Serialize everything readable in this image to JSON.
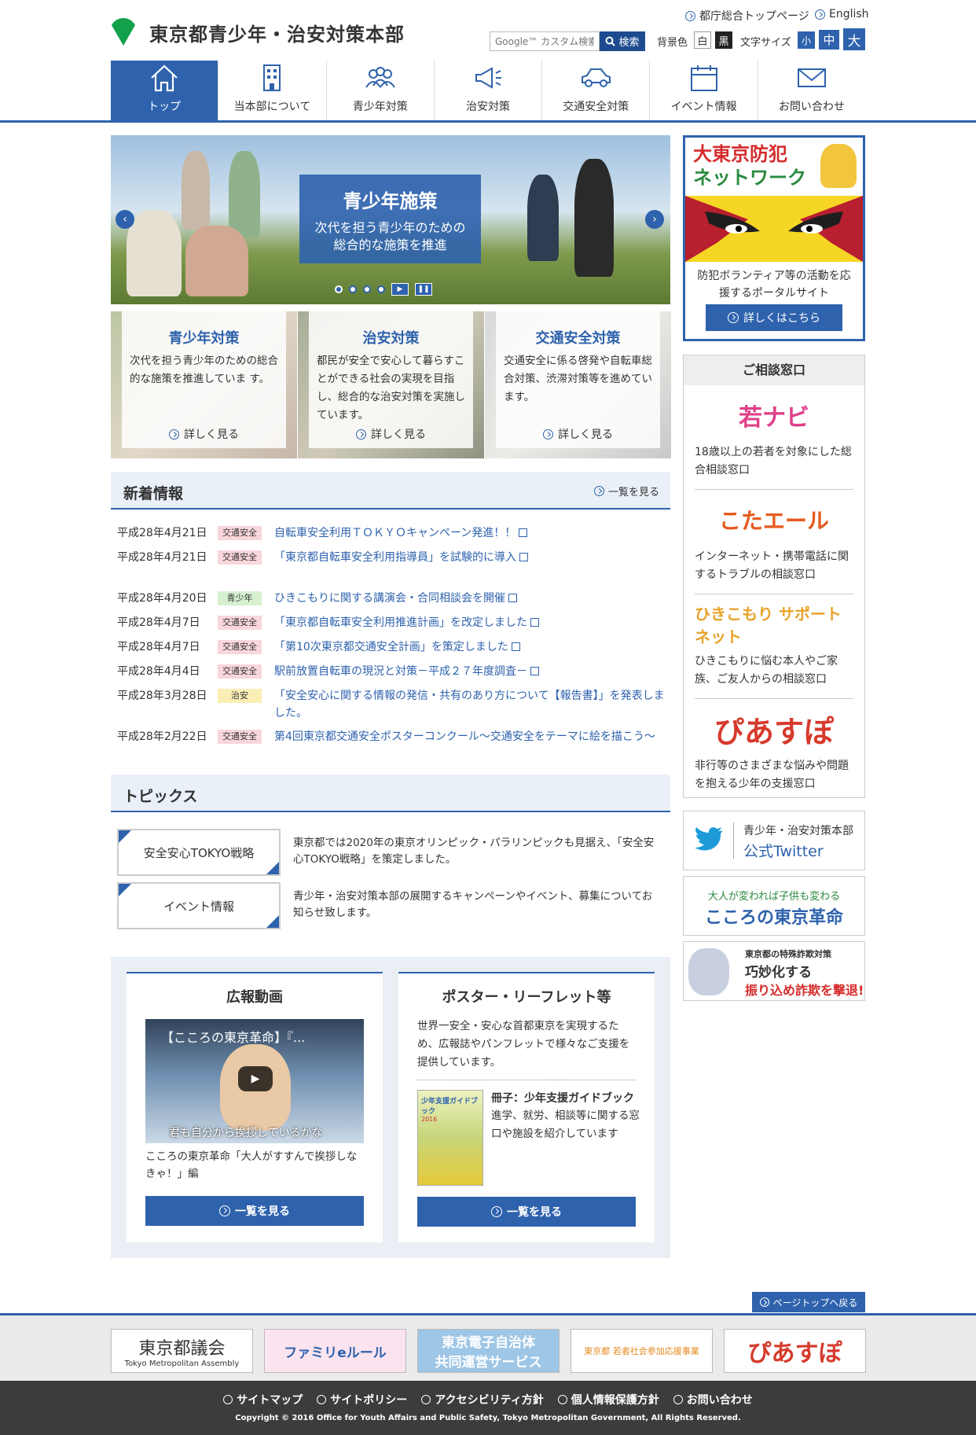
{
  "header": {
    "site_title": "東京都青少年・治安対策本部",
    "link_metro_top": "都庁総合トップページ",
    "link_english": "English",
    "search_placeholder": "Google™ カスタム検索",
    "search_button": "検索",
    "bg_color_label": "背景色",
    "bg_white": "白",
    "bg_black": "黒",
    "font_size_label": "文字サイズ",
    "font_small": "小",
    "font_medium": "中",
    "font_large": "大",
    "brand_color": "#2e62ad"
  },
  "nav": {
    "items": [
      {
        "label": "トップ",
        "icon": "home-icon"
      },
      {
        "label": "当本部について",
        "icon": "building-icon"
      },
      {
        "label": "青少年対策",
        "icon": "people-icon"
      },
      {
        "label": "治安対策",
        "icon": "megaphone-icon"
      },
      {
        "label": "交通安全対策",
        "icon": "car-icon"
      },
      {
        "label": "イベント情報",
        "icon": "calendar-icon"
      },
      {
        "label": "お問い合わせ",
        "icon": "mail-icon"
      }
    ]
  },
  "hero": {
    "title": "青少年施策",
    "subtitle_line1": "次代を担う青少年のための",
    "subtitle_line2": "総合的な施策を推進"
  },
  "features": [
    {
      "title": "青少年対策",
      "text": "次代を担う青少年のための総合的な施策を推進していま す。",
      "more": "詳しく見る"
    },
    {
      "title": "治安対策",
      "text": "都民が安全で安心して暮らすことができる社会の実現を目指し、総合的な治安対策を実施しています。",
      "more": "詳しく見る"
    },
    {
      "title": "交通安全対策",
      "text": "交通安全に係る啓発や自転車総合対策、渋滞対策等を進めています。",
      "more": "詳しく見る"
    }
  ],
  "news": {
    "heading": "新着情報",
    "more": "一覧を見る",
    "items": [
      {
        "date": "平成28年4月21日",
        "cat": "交通安全",
        "title": "自転車安全利用ＴＯＫＹＯキャンペーン発進！！"
      },
      {
        "date": "平成28年4月21日",
        "cat": "交通安全",
        "title": "「東京都自転車安全利用指導員」を試験的に導入"
      },
      {
        "date": "平成28年4月20日",
        "cat": "青少年",
        "title": "ひきこもりに関する講演会・合同相談会を開催"
      },
      {
        "date": "平成28年4月7日",
        "cat": "交通安全",
        "title": "「東京都自転車安全利用推進計画」を改定しました"
      },
      {
        "date": "平成28年4月7日",
        "cat": "交通安全",
        "title": "「第10次東京都交通安全計画」を策定しました"
      },
      {
        "date": "平成28年4月4日",
        "cat": "交通安全",
        "title": "駅前放置自転車の現況と対策－平成２７年度調査－"
      },
      {
        "date": "平成28年3月28日",
        "cat": "治安",
        "title": "「安全安心に関する情報の発信・共有のあり方について【報告書】」を発表しました。"
      },
      {
        "date": "平成28年2月22日",
        "cat": "交通安全",
        "title": "第4回東京都交通安全ポスターコンクール～交通安全をテーマに絵を描こう～"
      }
    ]
  },
  "topics": {
    "heading": "トピックス",
    "items": [
      {
        "button": "安全安心TOKYO戦略",
        "desc": "東京都では2020年の東京オリンピック・パラリンピックも見据え、「安全安心TOKYO戦略」を策定しました。"
      },
      {
        "button": "イベント情報",
        "desc": "青少年・治安対策本部の展開するキャンペーンやイベント、募集についてお知らせ致します。"
      }
    ]
  },
  "video_card": {
    "title": "広報動画",
    "video_title": "【こころの東京革命】『...",
    "video_subtitle": "君も自分から挨拶しているかな",
    "caption": "こころの東京革命「大人がすすんで挨拶しなきゃ！」編",
    "button": "一覧を見る"
  },
  "poster_card": {
    "title": "ポスター・リーフレット等",
    "intro": "世界一安全・安心な首都東京を実現するため、広報誌やパンフレットで様々なご支援を提供しています。",
    "booklet_title": "冊子：少年支援ガイドブック",
    "booklet_desc": "進学、就労、相談等に関する窓口や施設を紹介しています",
    "booklet_cover_label": "少年支援ガイドブック",
    "booklet_cover_year": "2016",
    "button": "一覧を見る"
  },
  "sidebar": {
    "bouhan_title_1": "大東京防犯",
    "bouhan_title_2": "ネットワーク",
    "bouhan_text": "防犯ボランティア等の活動を応援するポータルサイト",
    "bouhan_button": "詳しくはこちら",
    "soudan_heading": "ご相談窓口",
    "soudan_items": [
      {
        "logo": "若ナビ",
        "text": "18歳以上の若者を対象にした総合相談窓口"
      },
      {
        "logo": "こたエール",
        "text": "インターネット・携帯電話に関するトラブルの相談窓口"
      },
      {
        "logo": "ひきこもり サポートネット",
        "text": "ひきこもりに悩む本人やご家族、ご友人からの相談窓口"
      },
      {
        "logo": "ぴあすぽ",
        "text": "非行等のさまざまな悩みや問題を抱える少年の支援窓口"
      }
    ],
    "twitter_line1": "青少年・治安対策本部",
    "twitter_line2": "公式Twitter",
    "kokoro_line1": "大人が変われば子供も変わる",
    "kokoro_line2": "こころの東京革命",
    "fraud_line1": "東京都の特殊詐欺対策",
    "fraud_line2": "巧妙化する",
    "fraud_line3": "振り込め詐欺を撃退!"
  },
  "footer": {
    "page_top": "ページトップへ戻る",
    "banners": [
      {
        "line1": "東京都議会",
        "line2": "Tokyo Metropolitan Assembly"
      },
      {
        "line1": "ファミリeルール",
        "line2": ""
      },
      {
        "line1": "東京電子自治体",
        "line2": "共同運営サービス"
      },
      {
        "line1": "東京都 若者社会参加応援事業",
        "line2": ""
      },
      {
        "line1": "ぴあすぽ",
        "line2": ""
      }
    ],
    "links": [
      "サイトマップ",
      "サイトポリシー",
      "アクセシビリティ方針",
      "個人情報保護方針",
      "お問い合わせ"
    ],
    "copyright": "Copyright © 2016 Office for Youth Affairs and Public Safety, Tokyo Metropolitan Government, All Rights Reserved."
  }
}
